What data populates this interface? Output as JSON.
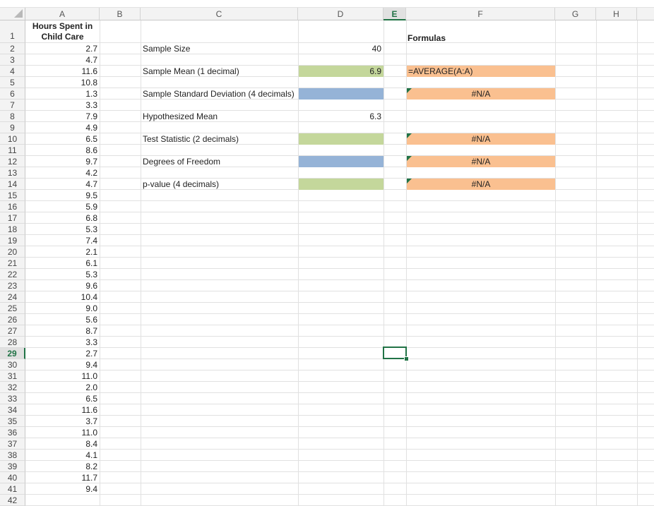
{
  "columns": [
    "A",
    "B",
    "C",
    "D",
    "E",
    "F",
    "G",
    "H"
  ],
  "selected_column": "E",
  "selected_row": "29",
  "header_a1": [
    "Hours Spent in",
    "Child Care"
  ],
  "hours": [
    "2.7",
    "4.7",
    "11.6",
    "10.8",
    "1.3",
    "3.3",
    "7.9",
    "4.9",
    "6.5",
    "8.6",
    "9.7",
    "4.2",
    "4.7",
    "9.5",
    "5.9",
    "6.8",
    "5.3",
    "7.4",
    "2.1",
    "6.1",
    "5.3",
    "9.6",
    "10.4",
    "9.0",
    "5.6",
    "8.7",
    "3.3",
    "2.7",
    "9.4",
    "11.0",
    "2.0",
    "6.5",
    "11.6",
    "3.7",
    "11.0",
    "8.4",
    "4.1",
    "8.2",
    "11.7",
    "9.4"
  ],
  "labels": {
    "sample_size": "Sample Size",
    "sample_mean": "Sample Mean (1 decimal)",
    "sample_sd": "Sample Standard Deviation (4 decimals)",
    "hyp_mean": "Hypothesized Mean",
    "test_stat": "Test Statistic (2 decimals)",
    "dof": "Degrees of Freedom",
    "pvalue": "p-value (4 decimals)",
    "formulas": "Formulas"
  },
  "values": {
    "sample_size": "40",
    "sample_mean": "6.9",
    "hyp_mean": "6.3"
  },
  "formulas": {
    "mean": "=AVERAGE(A:A)",
    "sd": "#N/A",
    "test_stat": "#N/A",
    "dof": "#N/A",
    "pvalue": "#N/A"
  },
  "colors": {
    "green": "#c4d79b",
    "blue": "#95b3d7",
    "orange": "#fac090",
    "selection": "#217346"
  }
}
